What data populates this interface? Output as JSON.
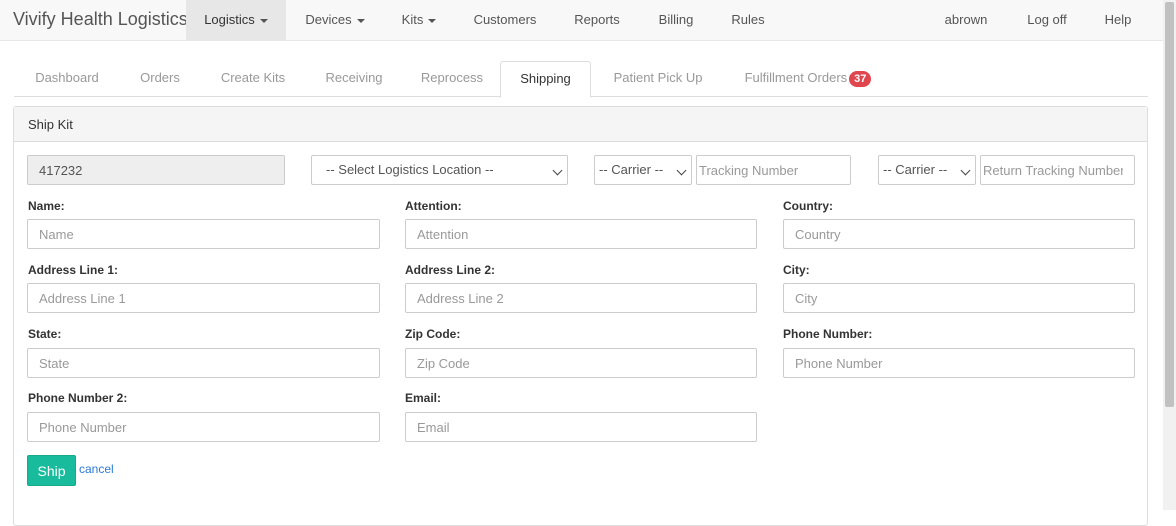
{
  "app": {
    "brand": "Vivify Health Logistics"
  },
  "nav": {
    "logistics": "Logistics",
    "devices": "Devices",
    "kits": "Kits",
    "customers": "Customers",
    "reports": "Reports",
    "billing": "Billing",
    "rules": "Rules",
    "user": "abrown",
    "logoff": "Log off",
    "help": "Help"
  },
  "tabs": {
    "dashboard": "Dashboard",
    "orders": "Orders",
    "create_kits": "Create Kits",
    "receiving": "Receiving",
    "reprocess": "Reprocess",
    "shipping": "Shipping",
    "patient_pickup": "Patient Pick Up",
    "fulfillment": "Fulfillment Orders",
    "fulfillment_count": "37"
  },
  "panel": {
    "title": "Ship Kit"
  },
  "form": {
    "kit_number": "417232",
    "location_select": "-- Select Logistics Location --",
    "carrier_select": "-- Carrier --",
    "tracking_placeholder": "Tracking Number",
    "return_carrier_select": "-- Carrier --",
    "return_tracking_placeholder": "Return Tracking Number",
    "name_label": "Name:",
    "name_placeholder": "Name",
    "attention_label": "Attention:",
    "attention_placeholder": "Attention",
    "country_label": "Country:",
    "country_placeholder": "Country",
    "address1_label": "Address Line 1:",
    "address1_placeholder": "Address Line 1",
    "address2_label": "Address Line 2:",
    "address2_placeholder": "Address Line 2",
    "city_label": "City:",
    "city_placeholder": "City",
    "state_label": "State:",
    "state_placeholder": "State",
    "zip_label": "Zip Code:",
    "zip_placeholder": "Zip Code",
    "phone_label": "Phone Number:",
    "phone_placeholder": "Phone Number",
    "phone2_label": "Phone Number 2:",
    "phone2_placeholder": "Phone Number",
    "email_label": "Email:",
    "email_placeholder": "Email",
    "ship_button": "Ship",
    "cancel_link": "cancel"
  }
}
